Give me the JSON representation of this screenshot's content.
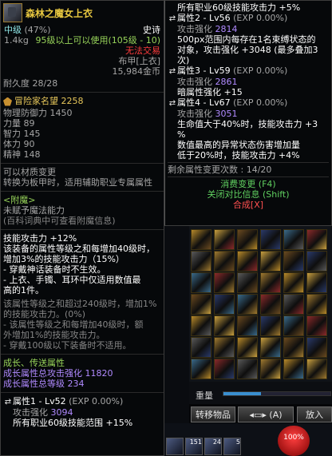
{
  "colors": {
    "gold": "#e6c65a",
    "cyan": "#8fe6e6",
    "red": "#ff3c3c",
    "green": "#98d45a",
    "grey": "#a5a5a5",
    "panel": "#06080a"
  },
  "item": {
    "title": "森林之魔女上衣",
    "grade": "中级",
    "grade_pct": "(47%)",
    "rarity": "史诗",
    "weight": "1.4kg",
    "level_req": "95级以上可以使用(105级 - 10)",
    "no_trade": "无法交易",
    "type": "布甲[上衣]",
    "price": "15,984金币",
    "durability": "耐久度 28/28",
    "adventurer_label": "冒险家名望",
    "adventurer_value": "2258",
    "stats": [
      {
        "name": "物理防御力",
        "value": "1450"
      },
      {
        "name": "力量",
        "value": "89"
      },
      {
        "name": "智力",
        "value": "145"
      },
      {
        "name": "体力",
        "value": "90"
      },
      {
        "name": "精神",
        "value": "148"
      }
    ],
    "material_change": "可以材质变更",
    "convert_info": "转换为板甲时，适用辅助职业专属属性",
    "enchant_header": "<附魔>",
    "enchant_none": "未赋予魔法能力",
    "enchant_hint": "(百科词典中可查看附魔信息)",
    "skill_atk": "技能攻击力 +12%",
    "effect_lines": [
      "该装备的属性等级之和每增加40级时，",
      "增加3%的技能攻击力（15%）",
      "- 穿戴神话装备时不生效。",
      "- 上衣、手镯、耳环中仅适用数值最",
      "高的1件。"
    ],
    "effect2_lines": [
      "该属性等级之和超过240级时，增加1%",
      "的技能攻击力。(0%)",
      "- 该属性等级之和每增加40级时，额",
      "外增加1%的技能攻击力。",
      "- 穿戴100级以下装备时不适用。"
    ],
    "growth_header": "成长、传送属性",
    "growth_total": "成长属性总攻击强化",
    "growth_total_value": "11820",
    "growth_level": "成长属性总等级",
    "growth_level_value": "234",
    "attr1_label": "属性1 - Lv52",
    "attr1_exp": "(EXP 0.00%)",
    "attr1_atk_label": "攻击强化",
    "attr1_atk_value": "3094",
    "attr1_desc": "所有职业60级技能范围 +15%"
  },
  "right": {
    "top_line": "所有职业60级技能攻击力 +5%",
    "attrs": [
      {
        "label": "属性2 - Lv56",
        "exp": "(EXP 0.00%)",
        "atk": "2814",
        "desc": [
          "500px范围内每存在1名束缚状态的",
          "对象，攻击强化 +3048 (最多叠加3",
          "次)"
        ]
      },
      {
        "label": "属性3 - Lv59",
        "exp": "(EXP 0.00%)",
        "atk": "2861",
        "desc": [
          "暗属性强化 +15"
        ]
      },
      {
        "label": "属性4 - Lv67",
        "exp": "(EXP 0.00%)",
        "atk": "3051",
        "desc": [
          "生命值大于40%时，技能攻击力 +3",
          "%",
          "数值最高的异常状态伤害增加量",
          "低于20%时，技能攻击力 +4%"
        ]
      }
    ],
    "atk_label": "攻击强化",
    "remaining": "剩余属性变更次数 : 14/20",
    "action_change": "消费变更 (F4)",
    "action_close": "关闭对比信息 (Shift)",
    "action_synth": "合成[X]"
  },
  "inventory": {
    "weight_label": "重量",
    "weight_fraction": 0.35,
    "transfer_button": "转移物品",
    "sort_button": "(A)",
    "put_button": "放入",
    "hp_text": "100%",
    "skill_counts": [
      "151",
      "24",
      "5"
    ]
  }
}
